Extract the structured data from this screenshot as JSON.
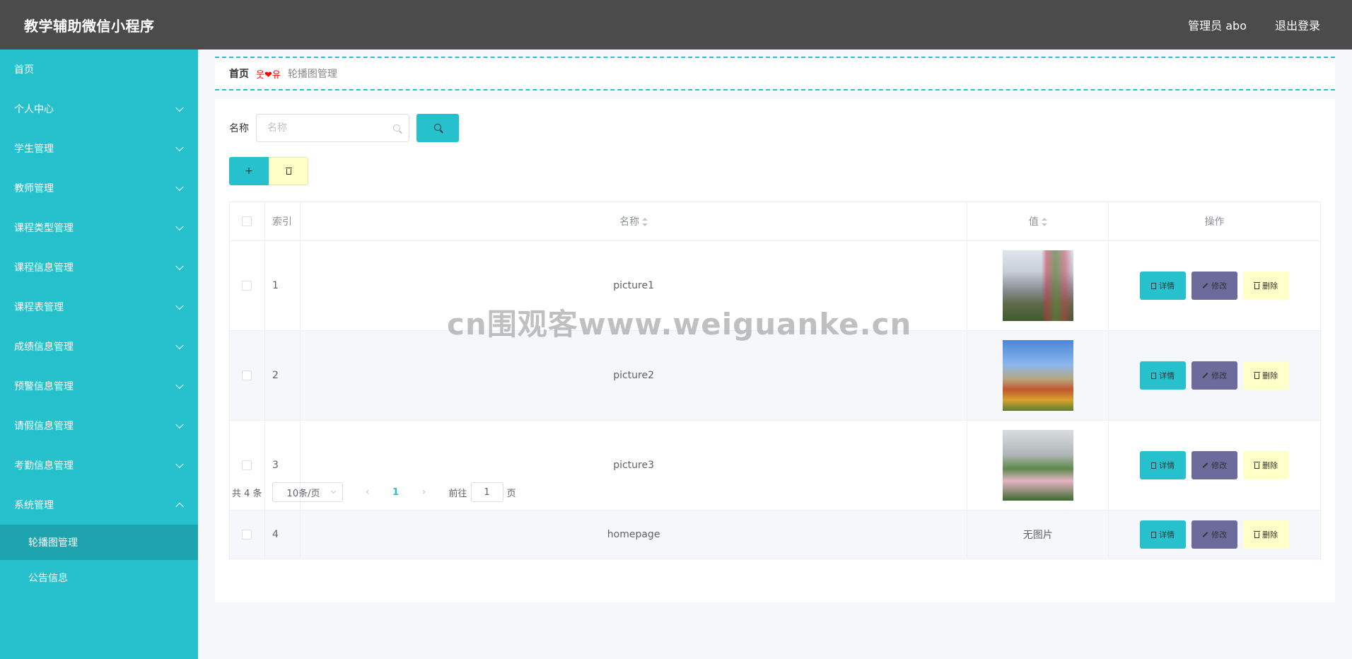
{
  "header": {
    "app_title": "教学辅助微信小程序",
    "user_label": "管理员 abo",
    "logout_label": "退出登录"
  },
  "sidebar": {
    "items": [
      {
        "label": "首页"
      },
      {
        "label": "个人中心"
      },
      {
        "label": "学生管理"
      },
      {
        "label": "教师管理"
      },
      {
        "label": "课程类型管理"
      },
      {
        "label": "课程信息管理"
      },
      {
        "label": "课程表管理"
      },
      {
        "label": "成绩信息管理"
      },
      {
        "label": "预警信息管理"
      },
      {
        "label": "请假信息管理"
      },
      {
        "label": "考勤信息管理"
      },
      {
        "label": "系统管理"
      }
    ],
    "submenu": [
      {
        "label": "轮播图管理",
        "active": true
      },
      {
        "label": "公告信息"
      }
    ]
  },
  "breadcrumb": {
    "home": "首页",
    "separator": "웃❤유",
    "current": "轮播图管理"
  },
  "search": {
    "label": "名称",
    "placeholder": "名称",
    "value": ""
  },
  "toolbar": {
    "add_label": "+"
  },
  "table": {
    "columns": [
      "索引",
      "名称",
      "值",
      "操作"
    ],
    "rows": [
      {
        "index": "1",
        "name": "picture1",
        "value": "",
        "image": "building-flowers"
      },
      {
        "index": "2",
        "name": "picture2",
        "value": "",
        "image": "campus-garden"
      },
      {
        "index": "3",
        "name": "picture3",
        "value": "",
        "image": "roses-campus"
      },
      {
        "index": "4",
        "name": "homepage",
        "value": "无图片",
        "image": ""
      }
    ],
    "ops": {
      "detail": "详情",
      "edit": "修改",
      "delete": "删除"
    }
  },
  "pagination": {
    "total_text": "共 4 条",
    "page_size": "10条/页",
    "current_page": "1",
    "goto_label": "前往",
    "goto_value": "1",
    "page_suffix": "页"
  },
  "watermark": "cn围观客www.weiguanke.cn",
  "colors": {
    "header_bg": "#4b4b4b",
    "sidebar_bg": "#26c1cc",
    "accent": "#26c1cc",
    "edit_btn": "#6d6a9c",
    "delete_btn": "#ffffc8"
  }
}
